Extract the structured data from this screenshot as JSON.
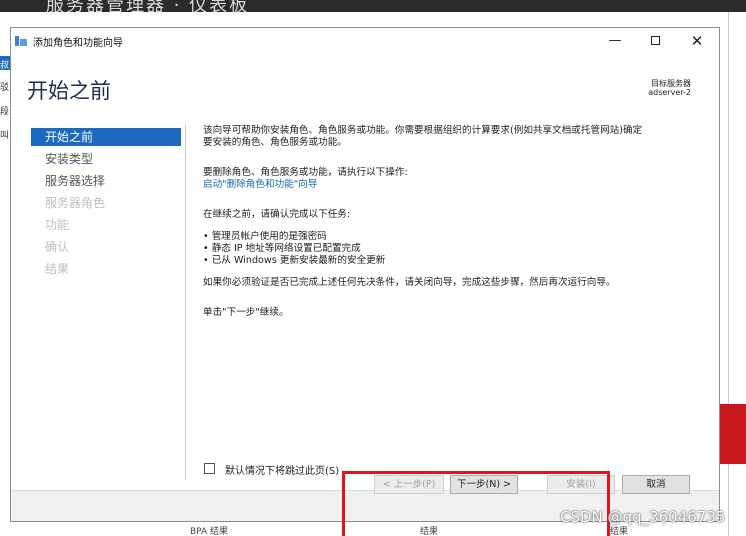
{
  "background": {
    "title": "服务器管理器 · 仪表板",
    "left_fragments": [
      "叔",
      "驳",
      "段",
      "叫"
    ],
    "bottom_fragments": [
      "BPA 结果",
      "结果",
      "结果"
    ]
  },
  "wizard": {
    "window_title": "添加角色和功能向导",
    "controls": {
      "minimize": "—",
      "maximize": "□",
      "close": "✕"
    },
    "heading": "开始之前",
    "target_server": {
      "label": "目标服务器",
      "value": "adserver-2"
    },
    "nav": [
      {
        "label": "开始之前",
        "state": "active"
      },
      {
        "label": "安装类型",
        "state": "normal"
      },
      {
        "label": "服务器选择",
        "state": "normal"
      },
      {
        "label": "服务器角色",
        "state": "disabled"
      },
      {
        "label": "功能",
        "state": "disabled"
      },
      {
        "label": "确认",
        "state": "disabled"
      },
      {
        "label": "结果",
        "state": "disabled"
      }
    ],
    "content": {
      "intro_line1": "该向导可帮助你安装角色、角色服务或功能。你需要根据组织的计算要求(例如共享文档或托管网站)确定",
      "intro_line2": "要安装的角色、角色服务或功能。",
      "remove_hint": "要删除角色、角色服务或功能，请执行以下操作:",
      "remove_link": "启动\"删除角色和功能\"向导",
      "before_tasks": "在继续之前，请确认完成以下任务:",
      "tasks": [
        "• 管理员帐户使用的是强密码",
        "• 静态 IP 地址等网络设置已配置完成",
        "• 已从 Windows 更新安装最新的安全更新"
      ],
      "verify_note": "如果你必须验证是否已完成上述任何先决条件，请关闭向导，完成这些步骤，然后再次运行向导。",
      "click_next": "单击\"下一步\"继续。"
    },
    "skip_checkbox": {
      "label": "默认情况下将跳过此页(S)",
      "checked": false
    },
    "buttons": {
      "prev": "< 上一步(P)",
      "next": "下一步(N) >",
      "install": "安装(I)",
      "cancel": "取消"
    }
  },
  "watermark": "CSDN @qq_36046735",
  "colors": {
    "accent": "#1b6ac0",
    "link": "#1466b8",
    "annotation": "#e0141c",
    "heading": "#1c2c4c"
  }
}
